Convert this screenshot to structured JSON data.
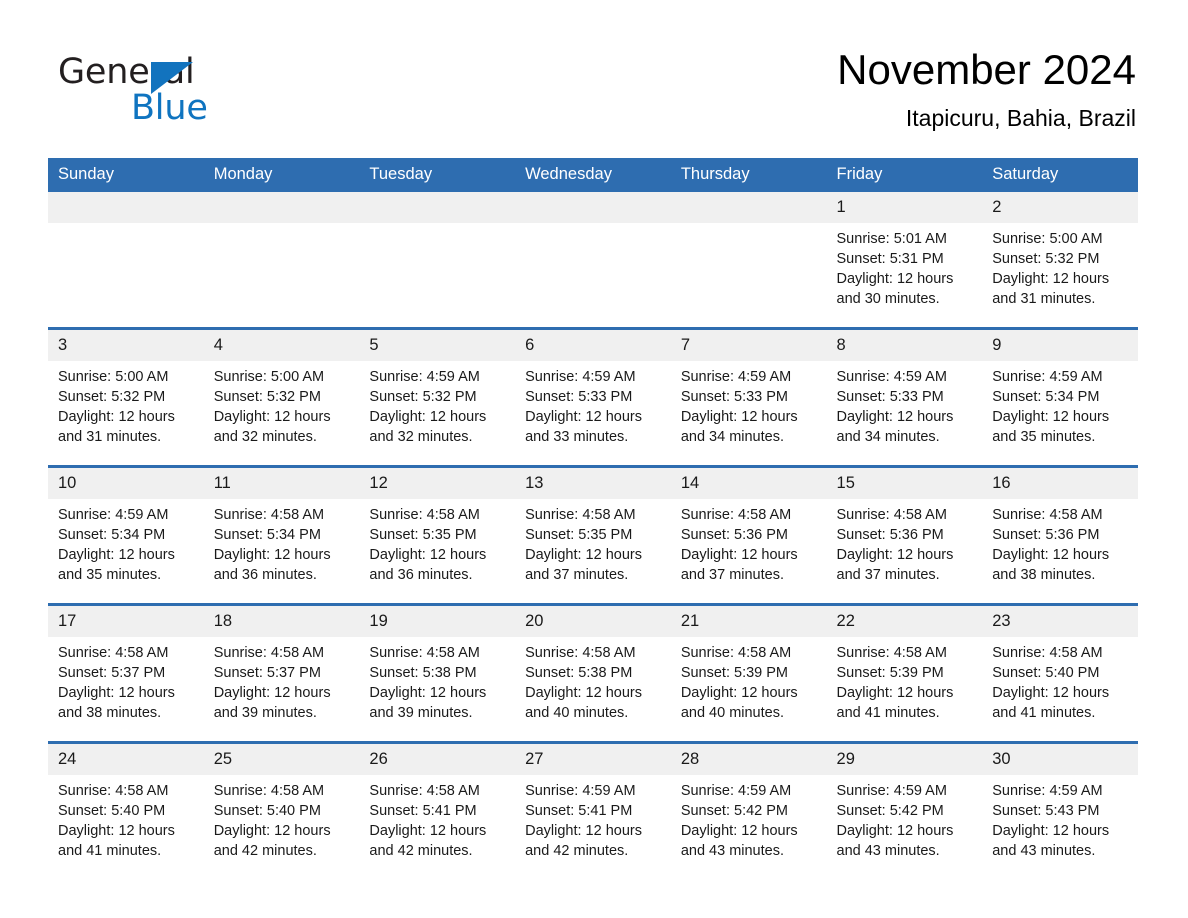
{
  "brand": {
    "name_part1": "General",
    "name_part2": "Blue",
    "triangle_icon": "triangle-icon",
    "accent_color": "#1273be"
  },
  "header": {
    "title": "November 2024",
    "location": "Itapicuru, Bahia, Brazil",
    "header_bg_color": "#2e6db0",
    "daynum_bg_color": "#f0f0f0"
  },
  "weekdays": [
    "Sunday",
    "Monday",
    "Tuesday",
    "Wednesday",
    "Thursday",
    "Friday",
    "Saturday"
  ],
  "weeks": [
    [
      {
        "day": "",
        "sunrise": "",
        "sunset": "",
        "daylight": ""
      },
      {
        "day": "",
        "sunrise": "",
        "sunset": "",
        "daylight": ""
      },
      {
        "day": "",
        "sunrise": "",
        "sunset": "",
        "daylight": ""
      },
      {
        "day": "",
        "sunrise": "",
        "sunset": "",
        "daylight": ""
      },
      {
        "day": "",
        "sunrise": "",
        "sunset": "",
        "daylight": ""
      },
      {
        "day": "1",
        "sunrise": "Sunrise: 5:01 AM",
        "sunset": "Sunset: 5:31 PM",
        "daylight": "Daylight: 12 hours and 30 minutes."
      },
      {
        "day": "2",
        "sunrise": "Sunrise: 5:00 AM",
        "sunset": "Sunset: 5:32 PM",
        "daylight": "Daylight: 12 hours and 31 minutes."
      }
    ],
    [
      {
        "day": "3",
        "sunrise": "Sunrise: 5:00 AM",
        "sunset": "Sunset: 5:32 PM",
        "daylight": "Daylight: 12 hours and 31 minutes."
      },
      {
        "day": "4",
        "sunrise": "Sunrise: 5:00 AM",
        "sunset": "Sunset: 5:32 PM",
        "daylight": "Daylight: 12 hours and 32 minutes."
      },
      {
        "day": "5",
        "sunrise": "Sunrise: 4:59 AM",
        "sunset": "Sunset: 5:32 PM",
        "daylight": "Daylight: 12 hours and 32 minutes."
      },
      {
        "day": "6",
        "sunrise": "Sunrise: 4:59 AM",
        "sunset": "Sunset: 5:33 PM",
        "daylight": "Daylight: 12 hours and 33 minutes."
      },
      {
        "day": "7",
        "sunrise": "Sunrise: 4:59 AM",
        "sunset": "Sunset: 5:33 PM",
        "daylight": "Daylight: 12 hours and 34 minutes."
      },
      {
        "day": "8",
        "sunrise": "Sunrise: 4:59 AM",
        "sunset": "Sunset: 5:33 PM",
        "daylight": "Daylight: 12 hours and 34 minutes."
      },
      {
        "day": "9",
        "sunrise": "Sunrise: 4:59 AM",
        "sunset": "Sunset: 5:34 PM",
        "daylight": "Daylight: 12 hours and 35 minutes."
      }
    ],
    [
      {
        "day": "10",
        "sunrise": "Sunrise: 4:59 AM",
        "sunset": "Sunset: 5:34 PM",
        "daylight": "Daylight: 12 hours and 35 minutes."
      },
      {
        "day": "11",
        "sunrise": "Sunrise: 4:58 AM",
        "sunset": "Sunset: 5:34 PM",
        "daylight": "Daylight: 12 hours and 36 minutes."
      },
      {
        "day": "12",
        "sunrise": "Sunrise: 4:58 AM",
        "sunset": "Sunset: 5:35 PM",
        "daylight": "Daylight: 12 hours and 36 minutes."
      },
      {
        "day": "13",
        "sunrise": "Sunrise: 4:58 AM",
        "sunset": "Sunset: 5:35 PM",
        "daylight": "Daylight: 12 hours and 37 minutes."
      },
      {
        "day": "14",
        "sunrise": "Sunrise: 4:58 AM",
        "sunset": "Sunset: 5:36 PM",
        "daylight": "Daylight: 12 hours and 37 minutes."
      },
      {
        "day": "15",
        "sunrise": "Sunrise: 4:58 AM",
        "sunset": "Sunset: 5:36 PM",
        "daylight": "Daylight: 12 hours and 37 minutes."
      },
      {
        "day": "16",
        "sunrise": "Sunrise: 4:58 AM",
        "sunset": "Sunset: 5:36 PM",
        "daylight": "Daylight: 12 hours and 38 minutes."
      }
    ],
    [
      {
        "day": "17",
        "sunrise": "Sunrise: 4:58 AM",
        "sunset": "Sunset: 5:37 PM",
        "daylight": "Daylight: 12 hours and 38 minutes."
      },
      {
        "day": "18",
        "sunrise": "Sunrise: 4:58 AM",
        "sunset": "Sunset: 5:37 PM",
        "daylight": "Daylight: 12 hours and 39 minutes."
      },
      {
        "day": "19",
        "sunrise": "Sunrise: 4:58 AM",
        "sunset": "Sunset: 5:38 PM",
        "daylight": "Daylight: 12 hours and 39 minutes."
      },
      {
        "day": "20",
        "sunrise": "Sunrise: 4:58 AM",
        "sunset": "Sunset: 5:38 PM",
        "daylight": "Daylight: 12 hours and 40 minutes."
      },
      {
        "day": "21",
        "sunrise": "Sunrise: 4:58 AM",
        "sunset": "Sunset: 5:39 PM",
        "daylight": "Daylight: 12 hours and 40 minutes."
      },
      {
        "day": "22",
        "sunrise": "Sunrise: 4:58 AM",
        "sunset": "Sunset: 5:39 PM",
        "daylight": "Daylight: 12 hours and 41 minutes."
      },
      {
        "day": "23",
        "sunrise": "Sunrise: 4:58 AM",
        "sunset": "Sunset: 5:40 PM",
        "daylight": "Daylight: 12 hours and 41 minutes."
      }
    ],
    [
      {
        "day": "24",
        "sunrise": "Sunrise: 4:58 AM",
        "sunset": "Sunset: 5:40 PM",
        "daylight": "Daylight: 12 hours and 41 minutes."
      },
      {
        "day": "25",
        "sunrise": "Sunrise: 4:58 AM",
        "sunset": "Sunset: 5:40 PM",
        "daylight": "Daylight: 12 hours and 42 minutes."
      },
      {
        "day": "26",
        "sunrise": "Sunrise: 4:58 AM",
        "sunset": "Sunset: 5:41 PM",
        "daylight": "Daylight: 12 hours and 42 minutes."
      },
      {
        "day": "27",
        "sunrise": "Sunrise: 4:59 AM",
        "sunset": "Sunset: 5:41 PM",
        "daylight": "Daylight: 12 hours and 42 minutes."
      },
      {
        "day": "28",
        "sunrise": "Sunrise: 4:59 AM",
        "sunset": "Sunset: 5:42 PM",
        "daylight": "Daylight: 12 hours and 43 minutes."
      },
      {
        "day": "29",
        "sunrise": "Sunrise: 4:59 AM",
        "sunset": "Sunset: 5:42 PM",
        "daylight": "Daylight: 12 hours and 43 minutes."
      },
      {
        "day": "30",
        "sunrise": "Sunrise: 4:59 AM",
        "sunset": "Sunset: 5:43 PM",
        "daylight": "Daylight: 12 hours and 43 minutes."
      }
    ]
  ]
}
